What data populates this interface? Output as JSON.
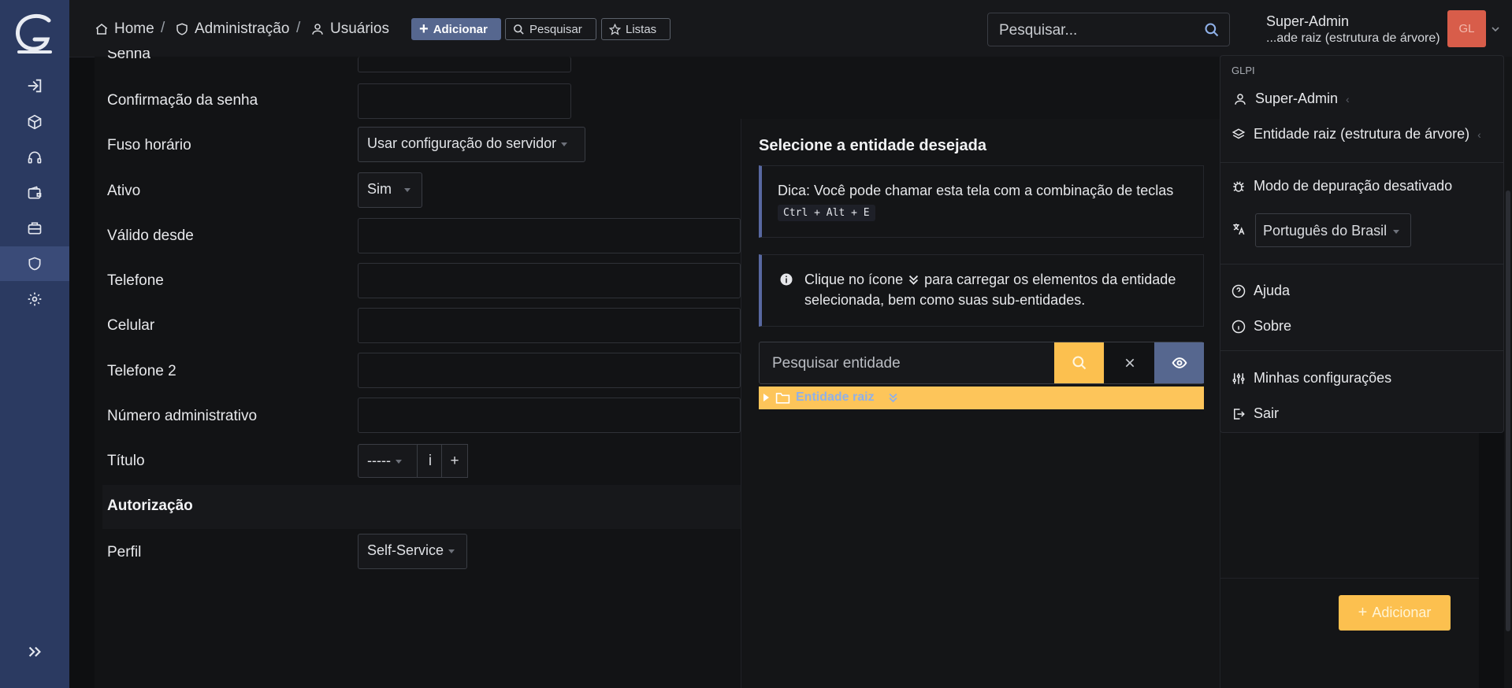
{
  "sidebar": {
    "logo": "glpi-logo",
    "items": [
      "sign-in-icon",
      "box-icon",
      "headset-icon",
      "wallet-icon",
      "briefcase-icon",
      "shield-icon",
      "gear-icon"
    ],
    "active_index": 5,
    "collapse_icon": "double-chevron-right-icon"
  },
  "breadcrumb": {
    "home": "Home",
    "admin": "Administração",
    "users": "Usuários",
    "separator": "/"
  },
  "toolbar": {
    "add_label": "Adicionar",
    "search_label": "Pesquisar",
    "lists_label": "Listas"
  },
  "top_search": {
    "placeholder": "Pesquisar..."
  },
  "user": {
    "name": "Super-Admin",
    "entity": "...ade raiz (estrutura de árvore)",
    "initials": "GL"
  },
  "form": {
    "partial_label": "Senha",
    "password_confirm": "Confirmação da senha",
    "timezone": "Fuso horário",
    "timezone_value": "Usar configuração do servidor",
    "active": "Ativo",
    "active_value": "Sim",
    "valid_from": "Válido desde",
    "phone": "Telefone",
    "mobile": "Celular",
    "phone2": "Telefone 2",
    "admin_number": "Número administrativo",
    "title": "Título",
    "title_value": "-----",
    "info_symbol": "i",
    "plus_symbol": "+",
    "authorization": "Autorização",
    "profile": "Perfil",
    "profile_value": "Self-Service"
  },
  "entity_modal": {
    "title": "Selecione a entidade desejada",
    "tip_text": "Dica: Você pode chamar esta tela com a combinação de teclas",
    "shortcut": "Ctrl + Alt + E",
    "info_part1": "Clique no ícone",
    "info_part2": "para carregar os elementos da entidade selecionada, bem como suas sub-entidades.",
    "search_placeholder": "Pesquisar entidade",
    "root_entity": "Entidade raiz"
  },
  "user_menu": {
    "header": "GLPI",
    "profile": "Super-Admin",
    "entity": "Entidade raiz (estrutura de árvore)",
    "debug": "Modo de depuração desativado",
    "language": "Português do Brasil",
    "help": "Ajuda",
    "about": "Sobre",
    "settings": "Minhas configurações",
    "logout": "Sair"
  },
  "add_button": "Adicionar",
  "colors": {
    "sidebar": "#2b3a61",
    "accent": "#fcc04f",
    "primary": "#56678f",
    "avatar": "#d85d4a"
  }
}
